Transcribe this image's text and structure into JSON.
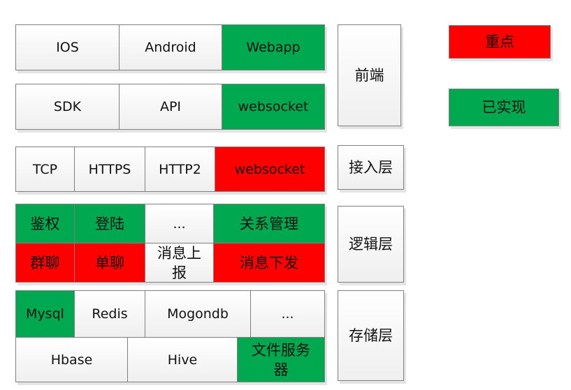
{
  "colors": {
    "implemented": "#00a84f",
    "key_point": "#ff0000",
    "default": "#f5f5f5"
  },
  "frontend": {
    "row1": [
      "IOS",
      "Android",
      "Webapp"
    ],
    "row2": [
      "SDK",
      "API",
      "websocket"
    ],
    "label": "前端"
  },
  "access": {
    "cells": [
      "TCP",
      "HTTPS",
      "HTTP2",
      "websocket"
    ],
    "label": "接入层"
  },
  "logic": {
    "top": [
      "鉴权",
      "登陆",
      "...",
      "关系管理"
    ],
    "bottom": [
      "群聊",
      "单聊",
      "消息上报",
      "消息下发"
    ],
    "label": "逻辑层"
  },
  "storage": {
    "top": [
      "Mysql",
      "Redis",
      "Mogondb",
      "..."
    ],
    "bottom": [
      "Hbase",
      "Hive",
      "文件服务器"
    ],
    "label": "存储层"
  },
  "legend": {
    "key_point": "重点",
    "implemented": "已实现"
  }
}
